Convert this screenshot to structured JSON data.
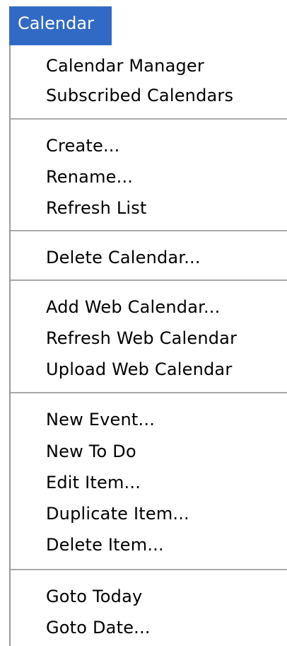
{
  "menu": {
    "title": "Calendar",
    "groups": [
      {
        "items": [
          "Calendar Manager",
          "Subscribed Calendars"
        ]
      },
      {
        "items": [
          "Create...",
          "Rename...",
          "Refresh List"
        ]
      },
      {
        "items": [
          "Delete Calendar..."
        ]
      },
      {
        "items": [
          "Add Web Calendar...",
          "Refresh Web Calendar",
          "Upload Web Calendar"
        ]
      },
      {
        "items": [
          "New Event...",
          "New To Do",
          "Edit Item...",
          "Duplicate Item...",
          "Delete Item..."
        ]
      },
      {
        "items": [
          "Goto Today",
          "Goto Date..."
        ]
      }
    ]
  },
  "colors": {
    "highlight": "#316ac5",
    "text": "#000000",
    "separator": "#a8a8a8"
  }
}
